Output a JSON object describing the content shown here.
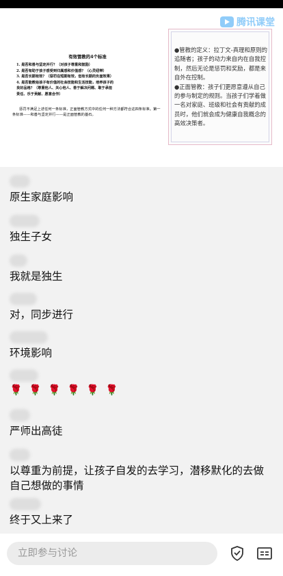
{
  "app": {
    "brand": "腾讯课堂"
  },
  "slide": {
    "doc_title": "有效管教的4个标准",
    "doc_items": [
      "1. 是否和善与坚定并行？（对孩子尊重和鼓励）",
      "2. 是否有助于孩子感受到归属感和价值感？（心灵纽带）",
      "3. 是否长期有效？（惩罚在短期有效，但有长期的负面效果）",
      "4. 是否能教给孩子有价值的社会技能和生活技能，培养孩子的",
      "良好品格？（尊重他人、关心他人、善于解决问题、敢于承担",
      "责任、乐于贡献、愿意合作）"
    ],
    "doc_paragraph": "惩罚不满足上述任何一条标准，正面管教方式中的任何一种方法都符合这四条标准。第一条标准——和善与坚定并行——是正面管教的基石。",
    "note_paragraphs": [
      "●管教的定义：拉丁文-真理和原则的追随者；孩子的动力来自内在自我控制，然后无论是惩罚和奖励，都是来自外在控制。",
      "●正面管教：孩子们更愿意遵从自己的参与制定的规则。当孩子们学着做一名对家庭、班级和社会有贡献的成员时，他们就会成为健康自我概念的高效决策者。"
    ]
  },
  "chat": {
    "messages": [
      {
        "text": "原生家庭影响"
      },
      {
        "text": "独生子女"
      },
      {
        "text": "我就是独生"
      },
      {
        "text": "对，同步进行"
      },
      {
        "text": "环境影响"
      },
      {
        "roses": [
          "🌹",
          "🌹",
          "🌹",
          "🌹",
          "🌹",
          "🌹"
        ]
      },
      {
        "text": "严师出高徒"
      },
      {
        "text": "以尊重为前提，让孩子自发的去学习，潜移默化的去做自己想做的事情"
      },
      {
        "text": "终于又上来了"
      }
    ]
  },
  "bottom": {
    "placeholder": "立即参与讨论",
    "icons": [
      "shield-icon",
      "subtitle-icon"
    ]
  }
}
